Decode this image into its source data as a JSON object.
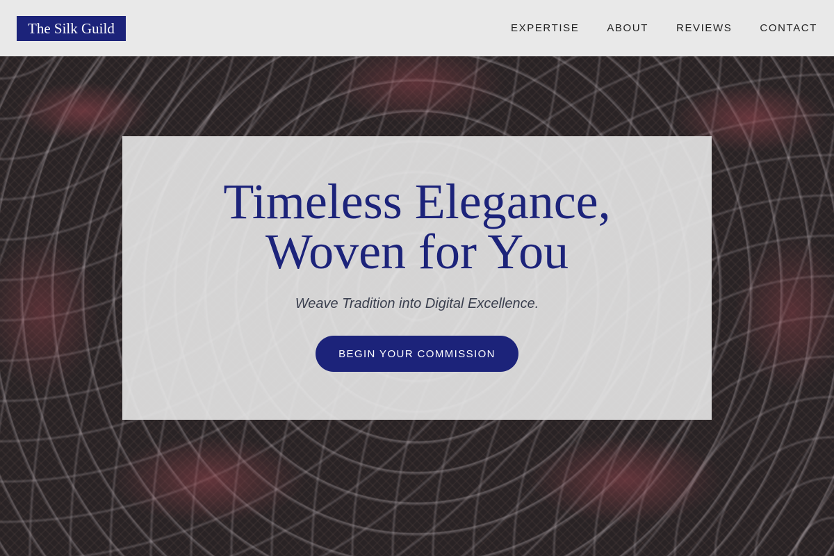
{
  "header": {
    "logo": "The Silk Guild",
    "nav": [
      {
        "label": "EXPERTISE"
      },
      {
        "label": "ABOUT"
      },
      {
        "label": "REVIEWS"
      },
      {
        "label": "CONTACT"
      }
    ]
  },
  "hero": {
    "title_line1": "Timeless Elegance,",
    "title_line2": "Woven for You",
    "subtitle": "Weave Tradition into Digital Excellence.",
    "cta_label": "BEGIN YOUR COMMISSION"
  },
  "colors": {
    "brand": "#1c237a",
    "header_bg": "#e9e9e9",
    "card_bg": "#e8e8e8",
    "text_dark": "#222222"
  }
}
